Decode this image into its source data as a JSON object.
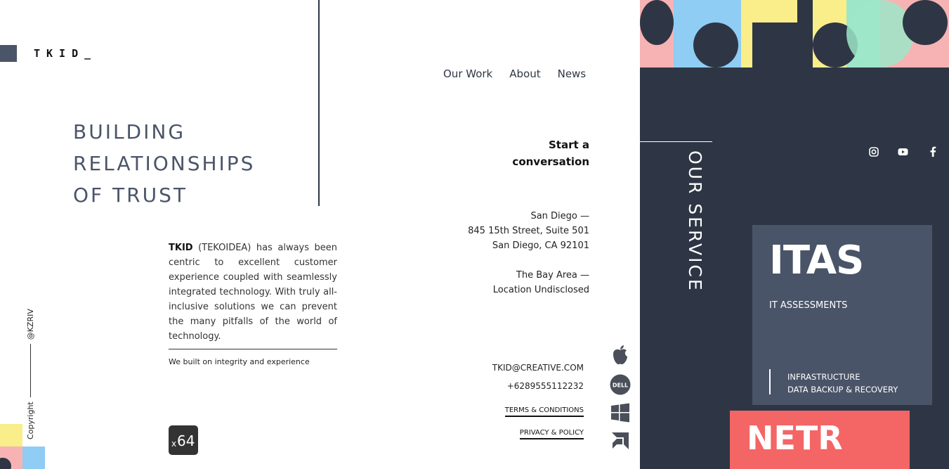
{
  "brand": {
    "logo": "TKID_"
  },
  "hero": {
    "lines": [
      "BUILDING",
      "RELATIONSHIPS",
      "OF TRUST"
    ]
  },
  "about": {
    "brand": "TKID",
    "text": " (TEKOIDEA) has always been centric to excellent customer experience coupled with seamlessly integrated technology. With truly all-inclusive solutions we can prevent the many pitfalls of the world of technology.",
    "tagline": "We built on integrity and experience"
  },
  "badge": {
    "prefix": "x",
    "value": "64"
  },
  "footer": {
    "copyright": "Copyright",
    "handle": "@KZRIV"
  },
  "nav": {
    "items": [
      "Our Work",
      "About",
      "News"
    ]
  },
  "contact": {
    "cta_line1": "Start a",
    "cta_line2": "conversation",
    "addr1": [
      "San Diego —",
      "845 15th Street, Suite 501",
      "San Diego, CA 92101"
    ],
    "addr2": [
      "The Bay Area —",
      "Location Undisclosed"
    ],
    "email": "TKID@CREATIVE.COM",
    "phone": "+6289555112232",
    "terms": "TERMS & CONDITIONS",
    "privacy": "PRIVACY & POLICY"
  },
  "tech": [
    "apple-icon",
    "dell-icon",
    "windows-icon",
    "amd-icon"
  ],
  "panel": {
    "section": "OUR SERVICE",
    "socials": [
      "instagram-icon",
      "youtube-icon",
      "facebook-icon"
    ],
    "itas": {
      "title": "ITAS",
      "subtitle": "IT ASSESSMENTS",
      "items": [
        "INFRASTRUCTURE",
        "DATA BACKUP & RECOVERY"
      ]
    },
    "netr": {
      "title": "NETR"
    }
  },
  "colors": {
    "dark": "#2e3645",
    "slate": "#4a5468",
    "coral": "#f46565",
    "yellow": "#f9ee8a",
    "blue": "#8fcdf4",
    "pink": "#f7b3b3",
    "mint": "#9ee6c8"
  }
}
